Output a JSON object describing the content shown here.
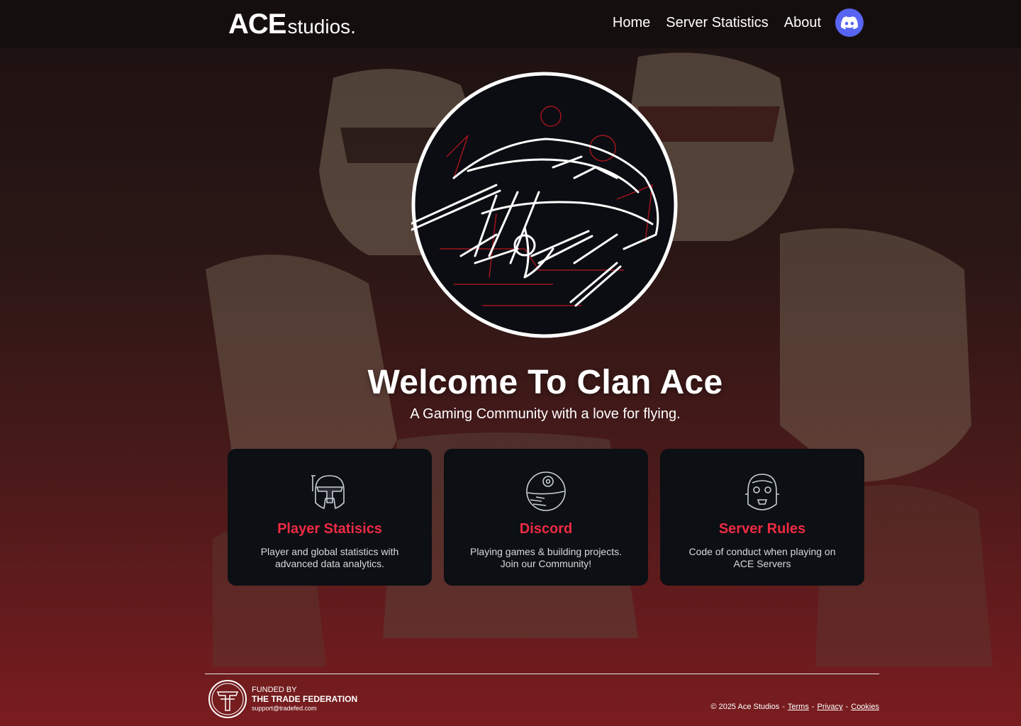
{
  "header": {
    "logo_strong": "ACE",
    "logo_light": "studios.",
    "nav": [
      {
        "label": "Home"
      },
      {
        "label": "Server Statistics"
      },
      {
        "label": "About"
      }
    ],
    "discord_icon": "discord-icon"
  },
  "hero": {
    "emblem_icon": "starship-emblem-icon",
    "title": "Welcome To Clan Ace",
    "subtitle": "A Gaming Community with a love for flying."
  },
  "cards": [
    {
      "icon": "mandalorian-helmet-icon",
      "title": "Player Statisics",
      "desc": "Player and global statistics with advanced data analytics."
    },
    {
      "icon": "death-star-icon",
      "title": "Discord",
      "desc": "Playing games & building projects. Join our Community!"
    },
    {
      "icon": "droid-head-icon",
      "title": "Server Rules",
      "desc": "Code of conduct when playing on ACE Servers"
    }
  ],
  "footer": {
    "sponsor_label": "FUNDED BY",
    "sponsor_name": "THE TRADE FEDERATION",
    "sponsor_email": "support@tradefed.com",
    "copyright": "© 2025 Ace Studios",
    "sep": "-",
    "links": [
      "Terms",
      "Privacy",
      "Cookies"
    ]
  },
  "colors": {
    "accent": "#ee2b43",
    "card_bg": "#0c0f14",
    "discord": "#5865f2"
  }
}
